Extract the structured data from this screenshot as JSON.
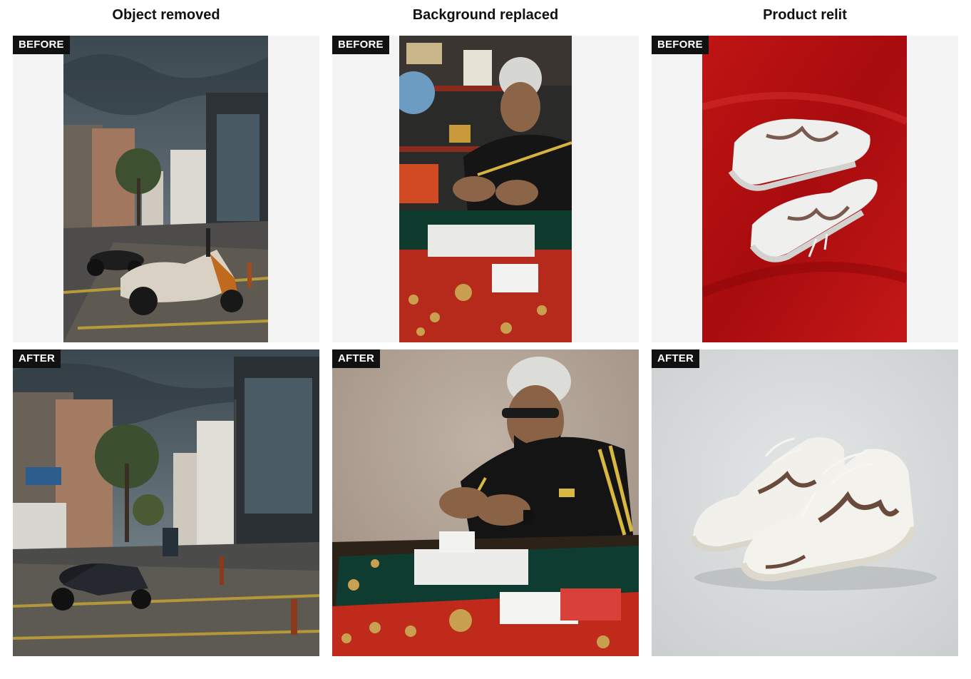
{
  "columns": [
    {
      "title": "Object removed",
      "before_label": "BEFORE",
      "after_label": "AFTER",
      "before_image": "street-with-two-scooters-photo",
      "after_image": "street-with-one-scooter-photo"
    },
    {
      "title": "Background replaced",
      "before_label": "BEFORE",
      "after_label": "AFTER",
      "before_image": "man-in-cluttered-shop-photo",
      "after_image": "man-plain-beige-background-photo"
    },
    {
      "title": "Product relit",
      "before_label": "BEFORE",
      "after_label": "AFTER",
      "before_image": "sneakers-on-red-satin-photo",
      "after_image": "sneakers-on-grey-backdrop-photo"
    }
  ],
  "colors": {
    "label_bg": "#111111",
    "label_text": "#ffffff",
    "sky": "#4f5d68",
    "shop_red": "#c42a1c",
    "satin_red": "#b80f10",
    "backdrop_grey": "#d9dcdc",
    "beige_wall": "#b3a497"
  }
}
